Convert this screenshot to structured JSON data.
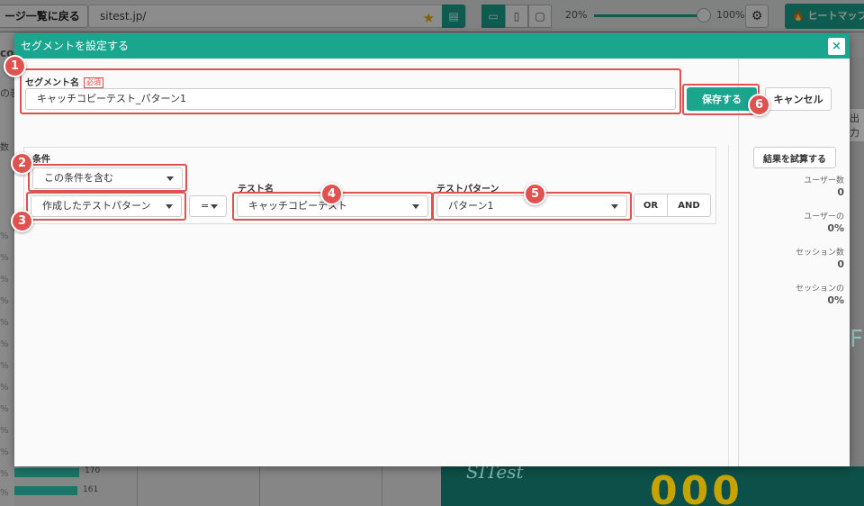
{
  "background": {
    "back_button_label": "ージ一覧に戻る",
    "url": "sitest.jp/",
    "zoom_min": "20%",
    "zoom_max": "100%",
    "heatmap_button_label": "ヒートマップ",
    "output_label": "出力",
    "side_letters": {
      "top": "co",
      "mid": "の表",
      "mid2": "数",
      "pct": "%"
    },
    "bar_values": [
      "170",
      "161"
    ],
    "hero_logo": "SITest",
    "hero_number": "000"
  },
  "modal": {
    "title": "セグメントを設定する",
    "close_label": "×",
    "segment_name_label": "セグメント名",
    "required_badge": "必須",
    "segment_name_value": "キャッチコピーテスト_パターン1",
    "save_label": "保存する",
    "cancel_label": "キャンセル",
    "condition_title": "条件",
    "include_select": "この条件を含む",
    "target_select": "作成したテストパターン",
    "operator_select": "=",
    "test_name_label": "テスト名",
    "test_name_select": "キャッチコピーテスト",
    "test_pattern_label": "テストパターン",
    "test_pattern_select": "パターン1",
    "or_label": "OR",
    "and_label": "AND"
  },
  "results": {
    "try_button": "結果を試算する",
    "stats": [
      {
        "label": "ユーザー数",
        "value": "0"
      },
      {
        "label": "ユーザーの",
        "value": "0%"
      },
      {
        "label": "セッション数",
        "value": "0"
      },
      {
        "label": "セッションの",
        "value": "0%"
      }
    ]
  },
  "annotations": [
    "1",
    "2",
    "3",
    "4",
    "5",
    "6"
  ],
  "colors": {
    "accent": "#1aa58f",
    "highlight": "#e0524f",
    "required": "#e24747"
  },
  "icons": {
    "star": "star-icon",
    "doc": "document-icon",
    "gear": "gear-icon",
    "close": "close-icon"
  }
}
